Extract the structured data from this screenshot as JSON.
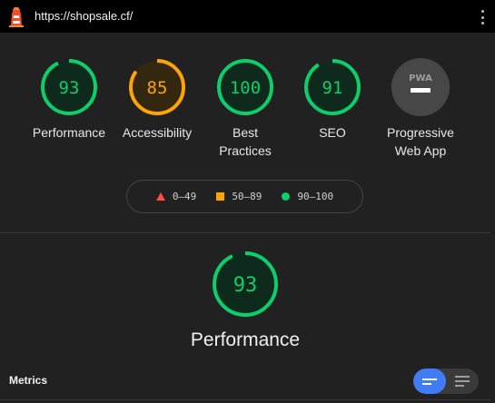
{
  "topbar": {
    "url": "https://shopsale.cf/",
    "logo_icon": "lighthouse-icon",
    "menu_icon": "kebab-menu-icon"
  },
  "colors": {
    "pass": "#0cce6b",
    "average": "#ffa400",
    "fail": "#ff4e42",
    "pwa_gray": "#9e9e9e",
    "accent": "#3f7cf6"
  },
  "categories": [
    {
      "id": "performance",
      "score": "93",
      "label": "Performance",
      "level": "pass"
    },
    {
      "id": "accessibility",
      "score": "85",
      "label": "Accessibility",
      "level": "average"
    },
    {
      "id": "best-practices",
      "score": "100",
      "label": "Best Practices",
      "level": "pass"
    },
    {
      "id": "seo",
      "score": "91",
      "label": "SEO",
      "level": "pass"
    },
    {
      "id": "pwa",
      "badge": "PWA",
      "label": "Progressive Web App",
      "level": "na"
    }
  ],
  "legend": {
    "fail": "0–49",
    "average": "50–89",
    "pass": "90–100"
  },
  "performance": {
    "score": "93",
    "title": "Performance"
  },
  "metrics": {
    "label": "Metrics",
    "toggle_icons": [
      "expanded-view-icon",
      "list-view-icon"
    ]
  }
}
